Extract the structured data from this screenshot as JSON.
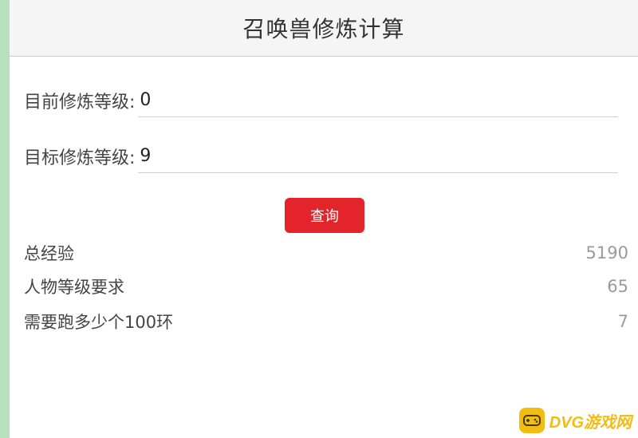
{
  "header": {
    "title": "召唤兽修炼计算"
  },
  "form": {
    "current_label": "目前修炼等级:",
    "current_value": "0",
    "target_label": "目标修炼等级:",
    "target_value": "9"
  },
  "actions": {
    "query_label": "查询"
  },
  "results": [
    {
      "label": "总经验",
      "value": "5190"
    },
    {
      "label": "人物等级要求",
      "value": "65"
    },
    {
      "label": "需要跑多少个100环",
      "value": "7"
    }
  ],
  "watermark": {
    "text": "DVG游戏网",
    "icon": "gamepad-icon",
    "color": "#f3b700"
  },
  "colors": {
    "accent": "#e3242b",
    "side_strip": "#b9dfc1"
  }
}
